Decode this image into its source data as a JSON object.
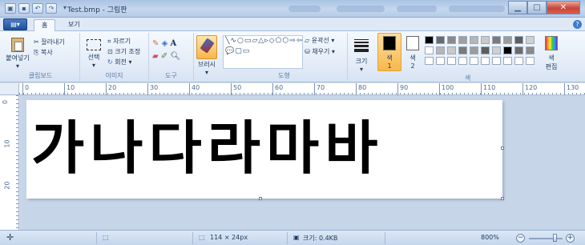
{
  "titlebar": {
    "title": "Test.bmp - 그림판"
  },
  "qat": {
    "save_icon": "save-icon",
    "undo_icon": "undo-icon",
    "redo_icon": "redo-icon"
  },
  "tabs": {
    "app_menu": "▤▾",
    "home": "홈",
    "view": "보기"
  },
  "ribbon": {
    "clipboard": {
      "paste": "붙여넣기",
      "cut": "잘라내기",
      "copy": "복사",
      "label": "클립보드"
    },
    "image": {
      "select": "선택",
      "crop": "자르기",
      "resize": "크기 조정",
      "rotate": "회전 ▾",
      "label": "이미지"
    },
    "tools": {
      "label": "도구"
    },
    "brushes": {
      "label": "브러시"
    },
    "shapes": {
      "outline": "윤곽선 ▾",
      "fill": "채우기 ▾",
      "label": "도형",
      "glyphs": "╲∿○▭▱△▹◇⬠⬡⇨⇦⇧⇩✧☆✡💬▢▭"
    },
    "size": {
      "label": "크기"
    },
    "colors": {
      "color1": "색\n1",
      "color1_a": "색",
      "color1_b": "1",
      "color2_a": "색",
      "color2_b": "2",
      "edit_a": "색",
      "edit_b": "편집",
      "label": "색",
      "color1_value": "#000000",
      "color2_value": "#ffffff"
    }
  },
  "ruler": {
    "marks": [
      "0",
      "10",
      "20",
      "30",
      "40",
      "50",
      "60",
      "70",
      "80",
      "90",
      "100",
      "110",
      "120",
      "130"
    ],
    "vmarks": [
      "0",
      "10",
      "20"
    ]
  },
  "canvas": {
    "text": "가나다라마바"
  },
  "status": {
    "dimensions": "114 × 24px",
    "size": "크기: 0.4KB",
    "zoom": "800%"
  }
}
